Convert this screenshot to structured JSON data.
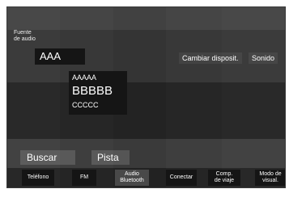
{
  "source_selector": {
    "label": "Fuente\nde audio"
  },
  "now_playing": {
    "header": "AAA",
    "line1": "AAAAA",
    "line2": "BBBBB",
    "line3": "CCCCC"
  },
  "top_actions": {
    "change_device": "Cambiar disposit.",
    "sound": "Sonido"
  },
  "middle_actions": {
    "search": "Buscar",
    "track": "Pista"
  },
  "bottom_bar": {
    "phone": "Teléfono",
    "fm": "FM",
    "bt_audio": "Audio\nBluetooth",
    "connect": "Conectar",
    "trip": "Comp.\nde viaje",
    "display_mode": "Modo de\nvisual."
  },
  "colors": {
    "screen_bg": "#2a2a2a",
    "panel_dark": "#151515",
    "text": "#ffffff"
  }
}
